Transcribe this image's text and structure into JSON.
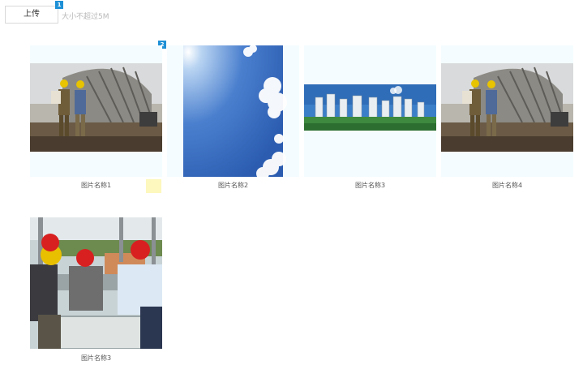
{
  "toolbar": {
    "upload_label": "上传",
    "hint": "大小不超过5M",
    "badge_upload": "1",
    "badge_gallery": "2"
  },
  "gallery": {
    "items": [
      {
        "caption": "图片名称1",
        "image": "workers-at-construction-site"
      },
      {
        "caption": "图片名称2",
        "image": "blue-sky-with-clouds"
      },
      {
        "caption": "图片名称3",
        "image": "high-rise-residential-buildings"
      },
      {
        "caption": "图片名称4",
        "image": "workers-at-construction-site"
      },
      {
        "caption": "图片名称3",
        "image": "engineers-in-hard-hats"
      }
    ]
  },
  "colors": {
    "accent": "#1e90d6",
    "card_bg": "#f4fcff",
    "hint_text": "#b8b8b8"
  }
}
